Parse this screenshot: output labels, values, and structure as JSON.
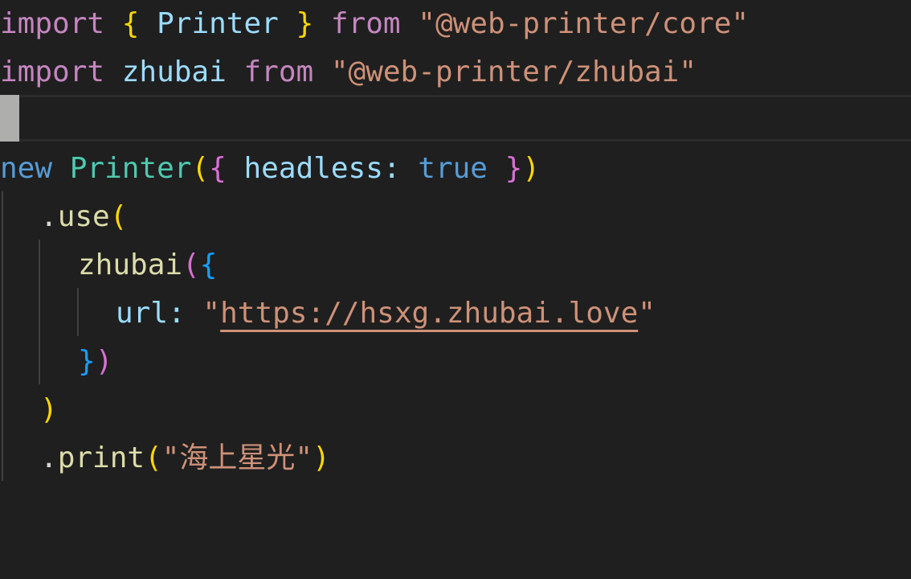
{
  "code": {
    "line1": {
      "import_kw": "import",
      "brace_open": "{",
      "printer_name": "Printer",
      "brace_close": "}",
      "from_kw": "from",
      "module": "\"@web-printer/core\""
    },
    "line2": {
      "import_kw": "import",
      "zhubai_name": "zhubai",
      "from_kw": "from",
      "module": "\"@web-printer/zhubai\""
    },
    "line4": {
      "new_kw": "new",
      "class_name": "Printer",
      "paren_open": "(",
      "brace_open": "{",
      "prop": "headless",
      "colon": ":",
      "value": "true",
      "brace_close": "}",
      "paren_close": ")"
    },
    "line5": {
      "dot": ".",
      "method": "use",
      "paren_open": "("
    },
    "line6": {
      "fn_name": "zhubai",
      "paren_open": "(",
      "brace_open": "{"
    },
    "line7": {
      "prop": "url",
      "colon": ":",
      "quote_open": "\"",
      "url": "https://hsxg.zhubai.love",
      "quote_close": "\""
    },
    "line8": {
      "brace_close": "}",
      "paren_close": ")"
    },
    "line9": {
      "paren_close": ")"
    },
    "line10": {
      "dot": ".",
      "method": "print",
      "paren_open": "(",
      "arg": "\"海上星光\"",
      "paren_close": ")"
    }
  },
  "colors": {
    "background": "#1f1f1f",
    "keyword_control": "#c586c0",
    "keyword_declaration": "#569cd6",
    "variable": "#9cdcfe",
    "class": "#4ec9b0",
    "function": "#dcdcaa",
    "string": "#ce9178",
    "bracket_level1": "#ffd700",
    "bracket_level2": "#da70d6",
    "bracket_level3": "#179fff"
  }
}
